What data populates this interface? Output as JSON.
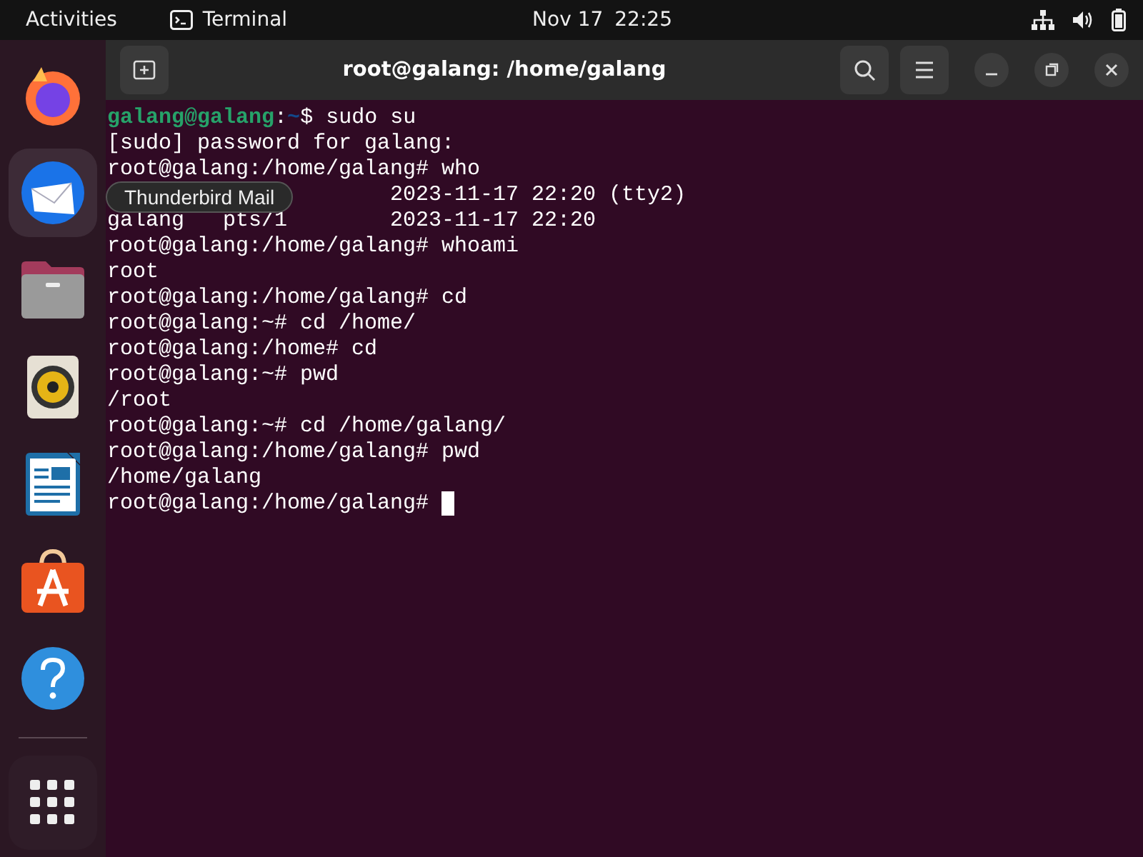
{
  "top_bar": {
    "activities": "Activities",
    "app_name": "Terminal",
    "date": "Nov 17",
    "time": "22:25"
  },
  "dock": {
    "items": [
      {
        "kind": "firefox",
        "selected": false
      },
      {
        "kind": "thunderbird",
        "selected": true
      },
      {
        "kind": "files",
        "selected": false
      },
      {
        "kind": "rhythmbox",
        "selected": false
      },
      {
        "kind": "writer",
        "selected": false
      },
      {
        "kind": "appcenter",
        "selected": false
      },
      {
        "kind": "help",
        "selected": false
      }
    ],
    "tooltip": "Thunderbird Mail"
  },
  "window": {
    "title": "root@galang: /home/galang"
  },
  "terminal": {
    "lines": [
      {
        "kind": "user_prompt",
        "user": "galang@galang",
        "separator": ":",
        "path": "~",
        "rest": "$ sudo su"
      },
      {
        "kind": "text",
        "text": "[sudo] password for galang:"
      },
      {
        "kind": "text",
        "text": "root@galang:/home/galang# who"
      },
      {
        "kind": "partly_hidden",
        "text": "2023-11-17 22:20 (tty2)"
      },
      {
        "kind": "text",
        "text": "galang   pts/1        2023-11-17 22:20"
      },
      {
        "kind": "text",
        "text": "root@galang:/home/galang# whoami"
      },
      {
        "kind": "text",
        "text": "root"
      },
      {
        "kind": "text",
        "text": "root@galang:/home/galang# cd"
      },
      {
        "kind": "text",
        "text": "root@galang:~# cd /home/"
      },
      {
        "kind": "text",
        "text": "root@galang:/home# cd"
      },
      {
        "kind": "text",
        "text": "root@galang:~# pwd"
      },
      {
        "kind": "text",
        "text": "/root"
      },
      {
        "kind": "text",
        "text": "root@galang:~# cd /home/galang/"
      },
      {
        "kind": "text",
        "text": "root@galang:/home/galang# pwd"
      },
      {
        "kind": "text",
        "text": "/home/galang"
      },
      {
        "kind": "cursor",
        "text": "root@galang:/home/galang# "
      }
    ]
  }
}
